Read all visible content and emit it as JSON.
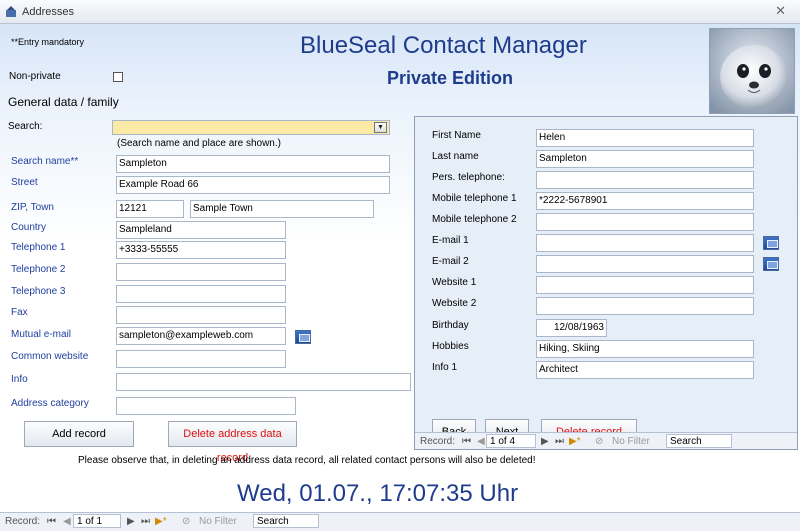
{
  "window": {
    "title": "Addresses",
    "close_glyph": "✕"
  },
  "header": {
    "entry_note": "**Entry mandatory",
    "app_title": "BlueSeal Contact Manager",
    "edition": "Private Edition"
  },
  "left": {
    "nonprivate_label": "Non-private",
    "section_label": "General data / family",
    "search_label": "Search:",
    "search_value": "",
    "search_hint": "(Search name and place are shown.)",
    "fields": {
      "search_name": {
        "label": "Search name**",
        "value": "Sampleton"
      },
      "street": {
        "label": "Street",
        "value": "Example Road 66"
      },
      "zip_town": {
        "label": "ZIP, Town",
        "zip": "12121",
        "town": "Sample Town"
      },
      "country": {
        "label": "Country",
        "value": "Sampleland"
      },
      "telephone1": {
        "label": "Telephone 1",
        "value": "+3333-55555"
      },
      "telephone2": {
        "label": "Telephone 2",
        "value": ""
      },
      "telephone3": {
        "label": "Telephone 3",
        "value": ""
      },
      "fax": {
        "label": "Fax",
        "value": ""
      },
      "mutual_email": {
        "label": "Mutual e-mail",
        "value": "sampleton@exampleweb.com"
      },
      "common_website": {
        "label": "Common website",
        "value": ""
      },
      "info": {
        "label": "Info",
        "value": ""
      },
      "address_category": {
        "label": "Address category",
        "value": ""
      }
    },
    "add_record": "Add record",
    "delete_address": "Delete address data record",
    "warning": "Please observe that, in deleting an address data record, all related contact persons  will also be deleted!",
    "clock": "Wed, 01.07., 17:07:35 Uhr"
  },
  "contact": {
    "fields": [
      {
        "label": "First Name",
        "value": "Helen"
      },
      {
        "label": "Last name",
        "value": "Sampleton"
      },
      {
        "label": "Pers. telephone:",
        "value": ""
      },
      {
        "label": "Mobile telephone 1",
        "value": "*2222-5678901"
      },
      {
        "label": "Mobile telephone 2",
        "value": ""
      },
      {
        "label": "E-mail 1",
        "value": ""
      },
      {
        "label": "E-mail 2",
        "value": ""
      },
      {
        "label": "Website 1",
        "value": ""
      },
      {
        "label": "Website 2",
        "value": ""
      },
      {
        "label": "Birthday",
        "value": "12/08/1963"
      },
      {
        "label": "Hobbies",
        "value": "Hiking, Skiing"
      },
      {
        "label": "Info 1",
        "value": "Architect"
      }
    ],
    "back": "Back",
    "next": "Next",
    "delete": "Delete record",
    "nav": {
      "record_label": "Record:",
      "position": "1 of 4",
      "filter": "No Filter",
      "search": "Search"
    }
  },
  "main_nav": {
    "record_label": "Record:",
    "position": "1 of 1",
    "filter": "No Filter",
    "search": "Search"
  },
  "colors": {
    "accent": "#1f3c8c",
    "label_blue": "#1f3f9f",
    "search_highlight": "#fbe9a6",
    "delete_red": "#dd1111"
  }
}
